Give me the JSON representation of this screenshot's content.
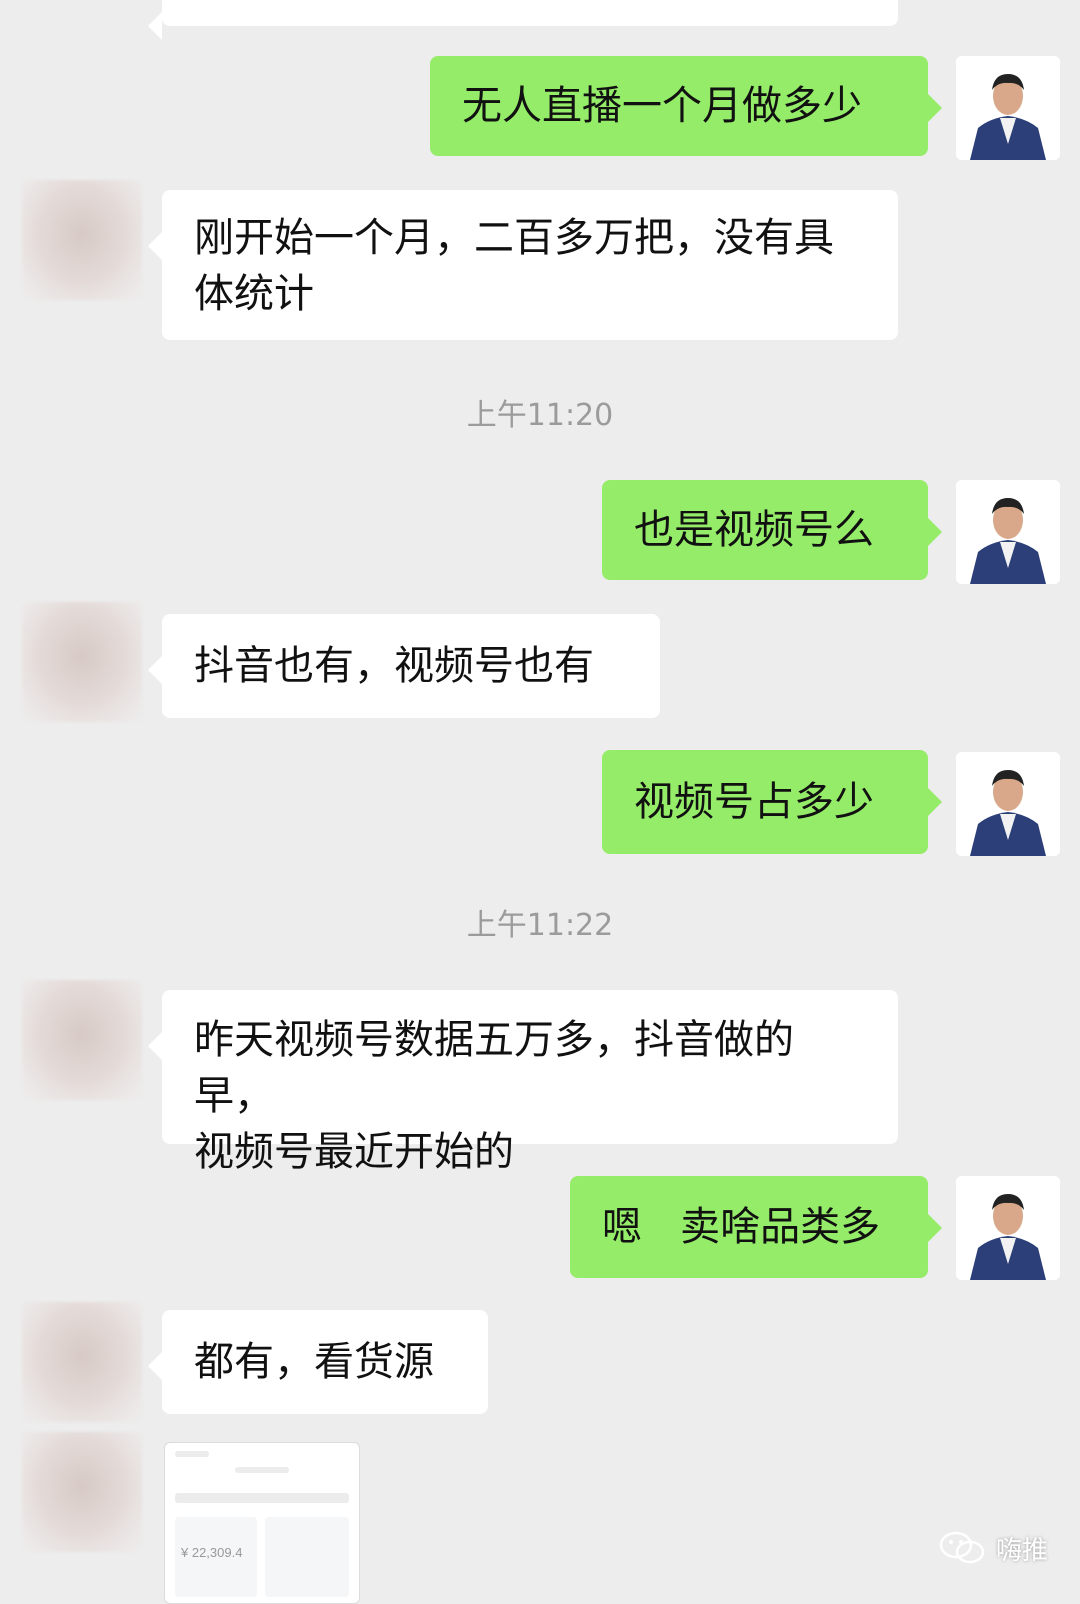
{
  "messages": [
    {
      "side": "right",
      "text": "无人直播一个月做多少"
    },
    {
      "side": "left",
      "line1": "刚开始一个月，二百多万把，没有具",
      "line2": "体统计"
    },
    {
      "side": "right",
      "text": "也是视频号么"
    },
    {
      "side": "left",
      "text": "抖音也有，视频号也有"
    },
    {
      "side": "right",
      "text": "视频号占多少"
    },
    {
      "side": "left",
      "line1": "昨天视频号数据五万多，抖音做的早，",
      "line2": "视频号最近开始的"
    },
    {
      "side": "right",
      "text": "嗯   卖啥品类多"
    },
    {
      "side": "left",
      "text": "都有，看货源"
    }
  ],
  "timestamps": [
    "上午11:20",
    "上午11:22"
  ],
  "thumbnail": {
    "amount": "¥ 22,309.4"
  },
  "watermark": {
    "text": "嗨推",
    "icon": "wechat-icon"
  },
  "colors": {
    "background": "#ededed",
    "self_bubble": "#95ec69",
    "other_bubble": "#ffffff",
    "timestamp": "#9b9b9b"
  }
}
